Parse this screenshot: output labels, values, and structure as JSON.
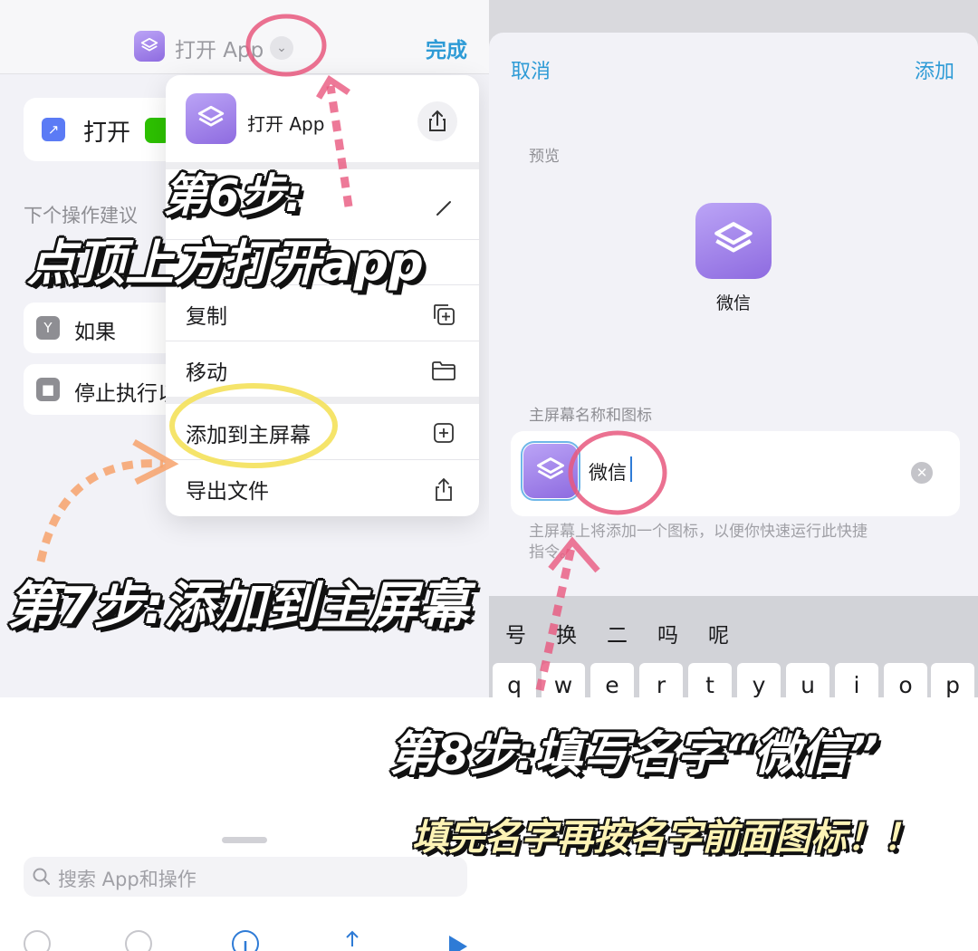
{
  "left_panel": {
    "header": {
      "title": "打开 App",
      "chevron": "⌄",
      "done": "完成"
    },
    "action_card": {
      "label": "打开",
      "app_icon": "wechat-icon"
    },
    "suggest_label": "下个操作建议",
    "suggestions": [
      {
        "label": "如果",
        "icon": "if-icon"
      },
      {
        "label": "停止执行以",
        "icon": "stop-icon"
      }
    ],
    "menu": {
      "title": "打开 App",
      "items": [
        {
          "label": "复制",
          "icon": "duplicate-icon"
        },
        {
          "label": "移动",
          "icon": "folder-icon"
        },
        {
          "label": "添加到主屏幕",
          "icon": "add-square-icon"
        },
        {
          "label": "导出文件",
          "icon": "share-icon"
        }
      ]
    },
    "search_placeholder": "搜索 App和操作"
  },
  "right_panel": {
    "cancel": "取消",
    "add": "添加",
    "preview_label": "预览",
    "preview_name": "微信",
    "home_label": "主屏幕名称和图标",
    "name_value": "微信",
    "hint": "主屏幕上将添加一个图标，以便你快速运行此快捷指令。",
    "candidates": [
      "号",
      "换",
      "二",
      "吗",
      "呢"
    ],
    "keys": [
      "q",
      "w",
      "e",
      "r",
      "t",
      "y",
      "u",
      "i",
      "o",
      "p"
    ]
  },
  "annotations": {
    "step6_line1": "第6步:",
    "step6_line2": "点顶上方打开app",
    "step7": "第7步:添加到主屏幕",
    "step8": "第8步:填写名字“微信”",
    "tip": "填完名字再按名字前面图标！！"
  },
  "colors": {
    "accent_blue": "#2e9bd6",
    "shortcut_purple": "#9f80ea",
    "circle_pink": "#e8587e",
    "circle_yellow": "#f4e15a",
    "arrow_orange": "#f7a26b"
  }
}
